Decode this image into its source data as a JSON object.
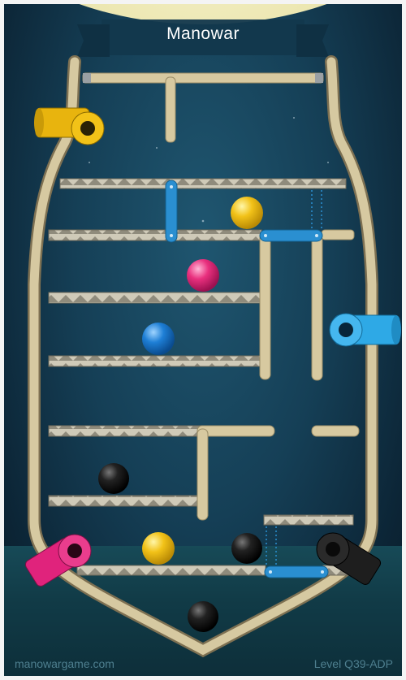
{
  "header": {
    "title": "Manowar"
  },
  "footer": {
    "site": "manowargame.com",
    "level": "Level Q39-ADP"
  },
  "colors": {
    "background": "#153f56",
    "wood": "#d7c9a0",
    "shelf": "#c9c4b2",
    "blue_gate": "#2a8fd1",
    "yellow": "#f2c218",
    "pink": "#e9307e",
    "blue": "#1e7fd6",
    "black": "#1b1b1b",
    "cyan_pipe": "#2ea9e6",
    "magenta_pipe": "#e0237c"
  },
  "balls": [
    {
      "color": "yellow",
      "name": "yellow-ball"
    },
    {
      "color": "pink",
      "name": "pink-ball"
    },
    {
      "color": "blue",
      "name": "blue-ball"
    },
    {
      "color": "black",
      "name": "black-ball"
    },
    {
      "color": "yellow",
      "name": "yellow-ball"
    },
    {
      "color": "black",
      "name": "black-ball"
    },
    {
      "color": "black",
      "name": "black-ball"
    }
  ],
  "pipes": [
    {
      "color": "yellow",
      "name": "yellow-pipe"
    },
    {
      "color": "cyan",
      "name": "cyan-pipe"
    },
    {
      "color": "magenta",
      "name": "magenta-pipe"
    },
    {
      "color": "black",
      "name": "black-pipe"
    }
  ]
}
